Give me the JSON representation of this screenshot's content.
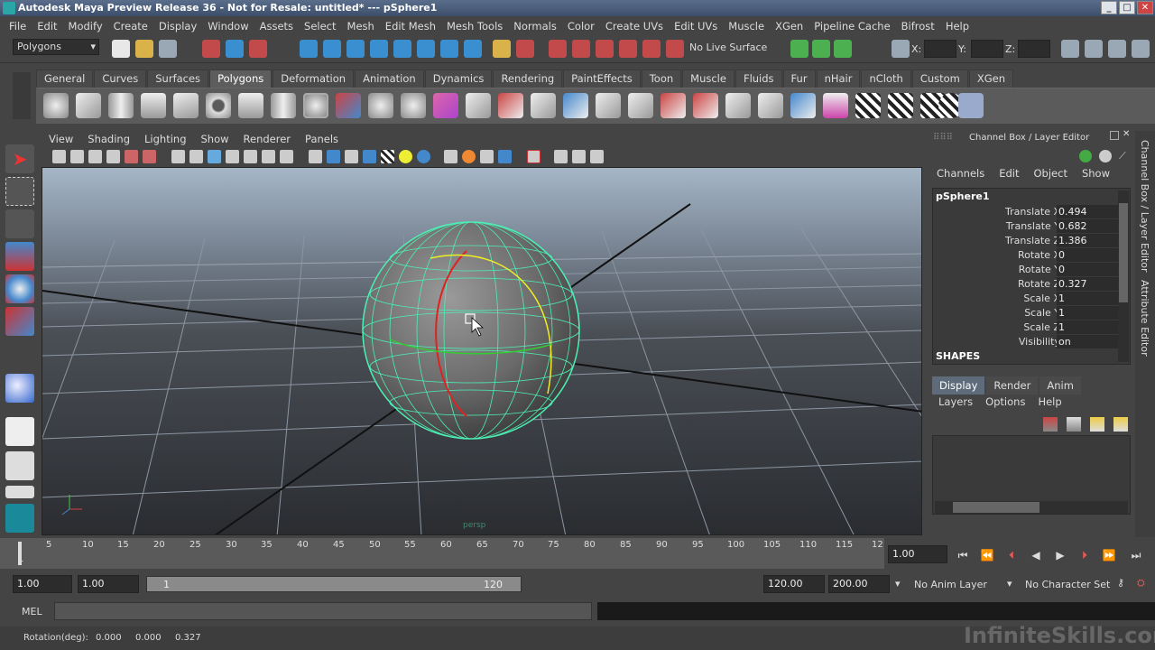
{
  "window": {
    "title": "Autodesk Maya Preview Release 36 - Not for Resale: untitled*   ---   pSphere1"
  },
  "menubar": [
    "File",
    "Edit",
    "Modify",
    "Create",
    "Display",
    "Window",
    "Assets",
    "Select",
    "Mesh",
    "Edit Mesh",
    "Mesh Tools",
    "Normals",
    "Color",
    "Create UVs",
    "Edit UVs",
    "Muscle",
    "XGen",
    "Pipeline Cache",
    "Bifrost",
    "Help"
  ],
  "status": {
    "menuset": "Polygons",
    "live_surface": "No Live Surface",
    "x_label": "X:",
    "y_label": "Y:",
    "z_label": "Z:"
  },
  "shelf_tabs": [
    "General",
    "Curves",
    "Surfaces",
    "Polygons",
    "Deformation",
    "Animation",
    "Dynamics",
    "Rendering",
    "PaintEffects",
    "Toon",
    "Muscle",
    "Fluids",
    "Fur",
    "nHair",
    "nCloth",
    "Custom",
    "XGen"
  ],
  "shelf_active": "Polygons",
  "panel_menu": [
    "View",
    "Shading",
    "Lighting",
    "Show",
    "Renderer",
    "Panels"
  ],
  "viewport": {
    "camera_label": "persp"
  },
  "channel_box": {
    "header": "Channel Box / Layer Editor",
    "menu": [
      "Channels",
      "Edit",
      "Object",
      "Show"
    ],
    "object": "pSphere1",
    "channels": [
      {
        "name": "Translate X",
        "value": "0.494"
      },
      {
        "name": "Translate Y",
        "value": "0.682"
      },
      {
        "name": "Translate Z",
        "value": "1.386"
      },
      {
        "name": "Rotate X",
        "value": "0"
      },
      {
        "name": "Rotate Y",
        "value": "0"
      },
      {
        "name": "Rotate Z",
        "value": "0.327"
      },
      {
        "name": "Scale X",
        "value": "1"
      },
      {
        "name": "Scale Y",
        "value": "1"
      },
      {
        "name": "Scale Z",
        "value": "1"
      },
      {
        "name": "Visibility",
        "value": "on"
      }
    ],
    "shapes_label": "SHAPES"
  },
  "layer_editor": {
    "tabs": [
      "Display",
      "Render",
      "Anim"
    ],
    "menu": [
      "Layers",
      "Options",
      "Help"
    ]
  },
  "side_tabs": [
    "Channel Box / Layer Editor",
    "Attribute Editor"
  ],
  "timeslider": {
    "ticks": [
      "5",
      "10",
      "15",
      "20",
      "25",
      "30",
      "35",
      "40",
      "45",
      "50",
      "55",
      "60",
      "65",
      "70",
      "75",
      "80",
      "85",
      "90",
      "95",
      "100",
      "105",
      "110",
      "115",
      "12"
    ],
    "start_frame": "1",
    "current_time": "1.00"
  },
  "range": {
    "start": "1.00",
    "playback_start": "1.00",
    "slider_start": "1",
    "slider_end": "120",
    "playback_end": "120.00",
    "end": "200.00",
    "anim_layer": "No Anim Layer",
    "char_set": "No Character Set"
  },
  "mel": {
    "label": "MEL"
  },
  "help_line": {
    "label": "Rotation(deg):",
    "x": "0.000",
    "y": "0.000",
    "z": "0.327"
  },
  "watermark": "InfiniteSkills.com"
}
